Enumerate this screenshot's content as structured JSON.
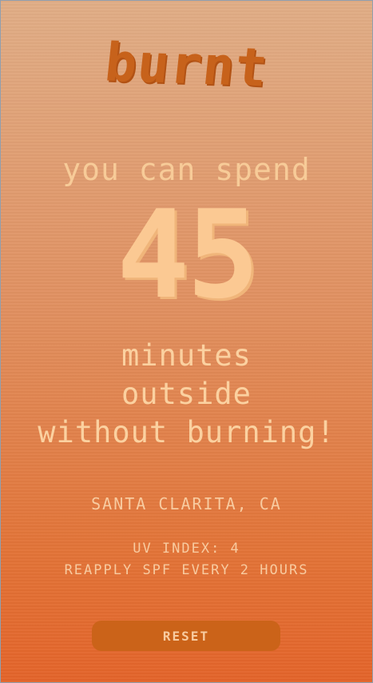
{
  "app": {
    "logo_text": "burnt"
  },
  "result": {
    "lead_text": "you can spend",
    "minutes": "45",
    "message_lines": [
      "minutes",
      "outside",
      "without burning!"
    ]
  },
  "info": {
    "location": "SANTA CLARITA, CA",
    "uv_index_text": "UV INDEX: 4",
    "reapply_text": "REAPPLY SPF EVERY 2 HOURS"
  },
  "actions": {
    "reset_label": "RESET"
  },
  "colors": {
    "background_top": "#e0ad86",
    "background_bottom": "#e3642a",
    "logo": "#c7621b",
    "text": "#f7cb98",
    "button": "#cb6319"
  }
}
